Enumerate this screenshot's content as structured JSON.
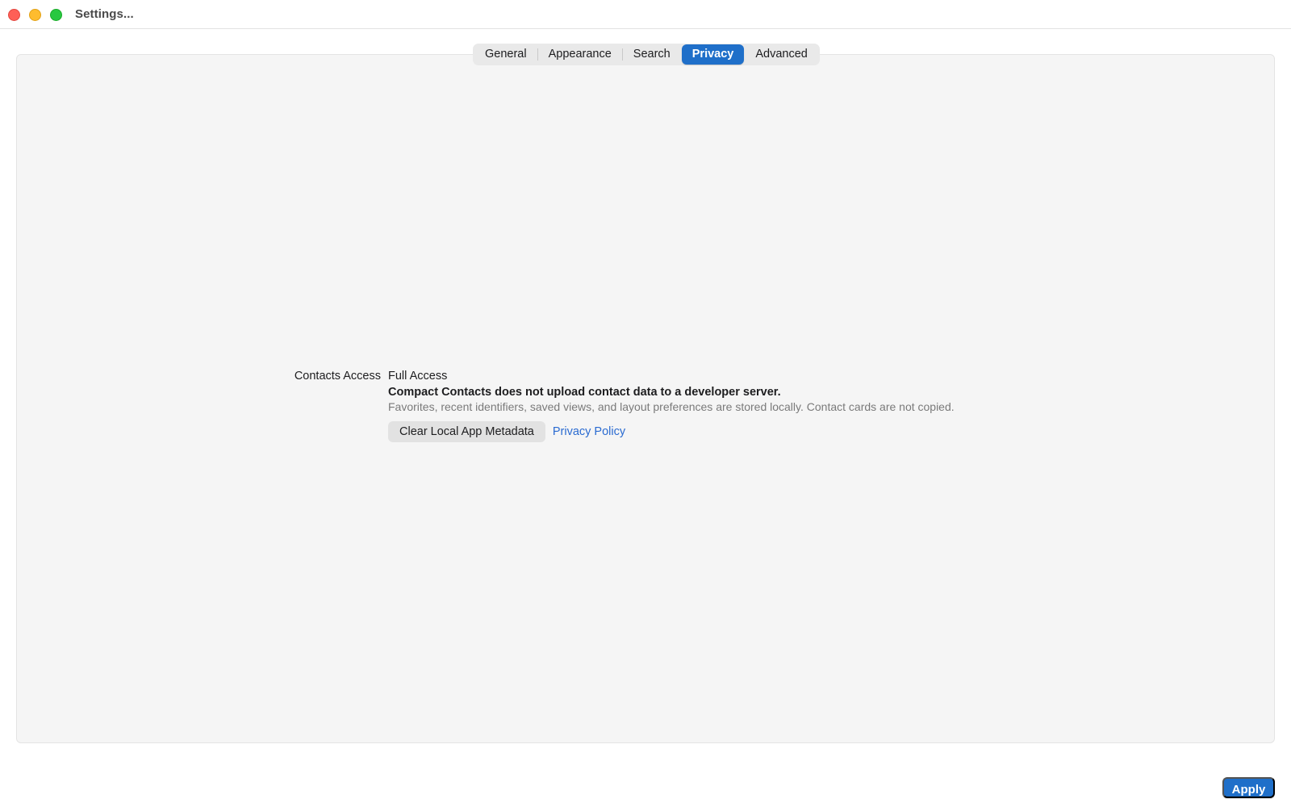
{
  "window": {
    "title": "Settings..."
  },
  "traffic_lights": {
    "close": "#fe5f57",
    "minimize": "#febc2e",
    "maximize": "#28c840"
  },
  "tabs": [
    {
      "label": "General",
      "active": false
    },
    {
      "label": "Appearance",
      "active": false
    },
    {
      "label": "Search",
      "active": false
    },
    {
      "label": "Privacy",
      "active": true
    },
    {
      "label": "Advanced",
      "active": false
    }
  ],
  "privacy": {
    "contacts_access_label": "Contacts Access",
    "contacts_access_value": "Full Access",
    "notice_title": "Compact Contacts does not upload contact data to a developer server.",
    "notice_detail": "Favorites, recent identifiers, saved views, and layout preferences are stored locally. Contact cards are not copied.",
    "clear_button_label": "Clear Local App Metadata",
    "policy_link_label": "Privacy Policy"
  },
  "footer": {
    "apply_label": "Apply"
  },
  "colors": {
    "accent": "#1f6fc9",
    "link": "#2a6bd1",
    "panel_background": "#f5f5f5"
  }
}
